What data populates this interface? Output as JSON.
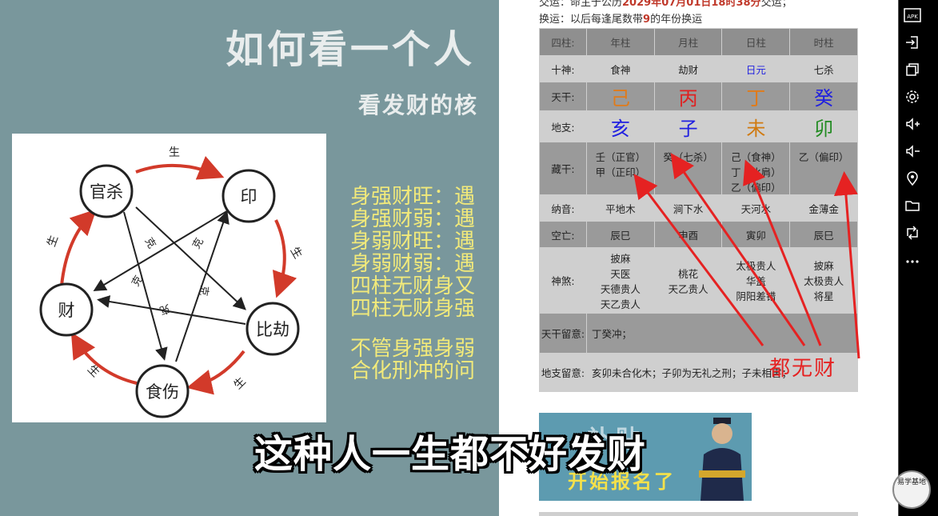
{
  "slide": {
    "title": "如何看一个人",
    "subtitle": "看发财的核",
    "lines": [
      "身强财旺：遇",
      "身强财弱：遇",
      "身弱财旺：遇",
      "身弱财弱：遇",
      "四柱无财身又",
      "四柱无财身强"
    ],
    "lines2": [
      "不管身强身弱",
      "合化刑冲的问"
    ],
    "diagram": {
      "nodes": [
        "官杀",
        "印",
        "比劫",
        "食伤",
        "财"
      ],
      "cycle_label": "生",
      "control_label": "克"
    }
  },
  "doc": {
    "line1_prefix": "交运：命主于公历",
    "line1_date": "2029年07月01日18时38分",
    "line1_suffix": "交运；",
    "line2_prefix": "换运：以后每逢尾数带",
    "line2_num": "9",
    "line2_suffix": "的年份换运",
    "table": {
      "headers": [
        "四柱:",
        "年柱",
        "月柱",
        "日柱",
        "时柱"
      ],
      "shishen": {
        "label": "十神:",
        "cells": [
          "食神",
          "劫财",
          "日元",
          "七杀"
        ]
      },
      "tiangan": {
        "label": "天干:",
        "cells": [
          "己",
          "丙",
          "丁",
          "癸"
        ],
        "colors": [
          "#e07b1a",
          "#e02020",
          "#e07b1a",
          "#2020e0"
        ]
      },
      "dizhi": {
        "label": "地支:",
        "cells": [
          "亥",
          "子",
          "未",
          "卯"
        ],
        "colors": [
          "#2020e0",
          "#2020e0",
          "#d07a10",
          "#228b22"
        ]
      },
      "canggan": {
        "label": "藏干:",
        "cells": [
          "壬（正官）\n甲（正印）",
          "癸（七杀）",
          "己（食神）\n丁（比肩）\n乙（偏印）",
          "乙（偏印）"
        ]
      },
      "nayin": {
        "label": "纳音:",
        "cells": [
          "平地木",
          "涧下水",
          "天河水",
          "金薄金"
        ]
      },
      "kongwang": {
        "label": "空亡:",
        "cells": [
          "辰巳",
          "申酉",
          "寅卯",
          "辰巳"
        ]
      },
      "shensha": {
        "label": "神煞:",
        "cells": [
          "披麻\n天医\n天德贵人\n天乙贵人",
          "桃花\n天乙贵人",
          "太极贵人\n华盖\n阴阳差错",
          "披麻\n太极贵人\n将星"
        ]
      },
      "tgnote": {
        "label": "天干留意:",
        "text": "丁癸冲；"
      },
      "dznote": {
        "label": "地支留意:",
        "text": "亥卯未合化木；子卯为无礼之刑；子未相害；"
      }
    },
    "annotation": "都无财",
    "ad": {
      "top": "补贴",
      "text": "开始报名了"
    }
  },
  "caption": "这种人一生都不好发财",
  "toolbar": {
    "items": [
      "APK",
      "import",
      "windows",
      "settings",
      "volume-up",
      "volume-down",
      "location",
      "folder",
      "rotate",
      "more"
    ]
  },
  "seal": "易学基地"
}
